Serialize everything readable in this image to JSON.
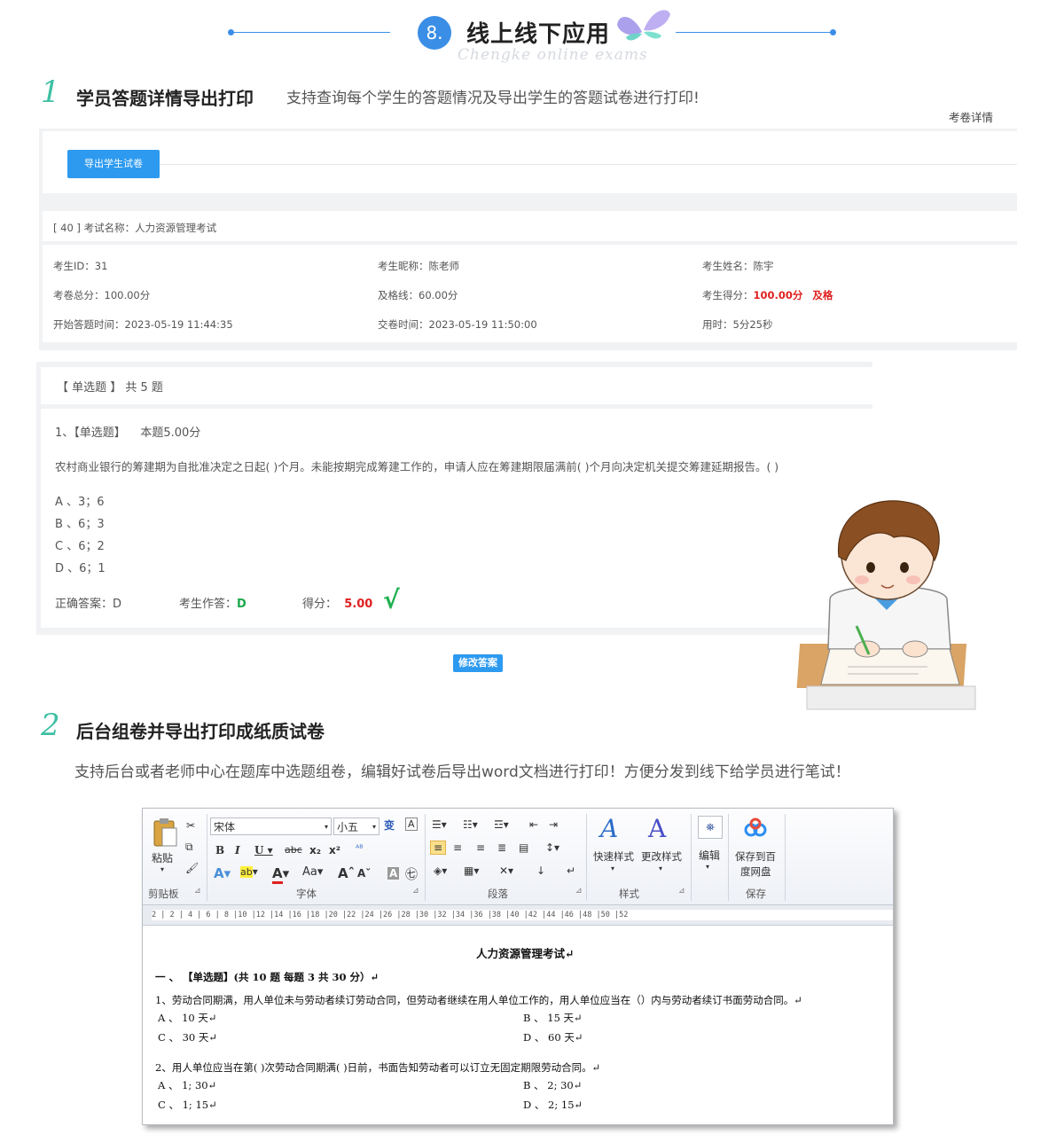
{
  "header": {
    "badge": "8.",
    "title": "线上线下应用",
    "subtitle": "Chengke online exams"
  },
  "section1": {
    "number": "1",
    "title": "学员答题详情导出打印",
    "desc": "支持查询每个学生的答题情况及导出学生的答题试卷进行打印!",
    "tab_label": "考卷详情",
    "export_button": "导出学生试卷",
    "exam_header": "[ 40 ] 考试名称：人力资源管理考试",
    "info": {
      "student_id": "考生ID：31",
      "nickname": "考生昵称：陈老师",
      "name": "考生姓名：陈宇",
      "total_label": "考卷总分：100.00分",
      "pass_line": "及格线：60.00分",
      "score_label": "考生得分：",
      "score_value": "100.00分",
      "pass_status": "及格",
      "start_time": "开始答题时间：2023-05-19 11:44:35",
      "submit_time": "交卷时间：2023-05-19 11:50:00",
      "duration": "用时：5分25秒"
    },
    "question_type_header": "【 单选题 】 共 5 题",
    "question": {
      "head": "1、【单选题】",
      "points": "本题5.00分",
      "text": "农村商业银行的筹建期为自批准决定之日起( )个月。未能按期完成筹建工作的，申请人应在筹建期限届满前( )个月向决定机关提交筹建延期报告。( )",
      "options": [
        "A 、3；6",
        "B 、6；3",
        "C 、6；2",
        "D 、6；1"
      ],
      "correct_label": "正确答案：D",
      "answer_label": "考生作答：",
      "answer_value": "D",
      "score_label": "得分：",
      "score_value": "5.00",
      "check_mark": "√"
    },
    "modify_button": "修改答案"
  },
  "section2": {
    "number": "2",
    "title": "后台组卷并导出打印成纸质试卷",
    "desc": "支持后台或者老师中心在题库中选题组卷，编辑好试卷后导出word文档进行打印！方便分发到线下给学员进行笔试！"
  },
  "word": {
    "paste": "粘贴",
    "font_name": "宋体",
    "font_size": "小五",
    "quick_style": "快速样式",
    "change_style": "更改样式",
    "edit": "编辑",
    "save_baidu_1": "保存到百",
    "save_baidu_2": "度网盘",
    "groups": [
      "剪贴板",
      "字体",
      "段落",
      "样式",
      "保存"
    ],
    "ruler": "2 | 2 | 4 | 6 | 8 |10 |12 |14 |16 |18 |20 |22 |24 |26 |28 |30 |32 |34 |36 |38 |40 |42 |44 |46 |48 |50 |52",
    "doc_title": "人力资源管理考试↵",
    "section_head": "一 、  【单选题】(共 10 题 每题 3 共 30 分）↵",
    "q1": "1、劳动合同期满，用人单位未与劳动者续订劳动合同，但劳动者继续在用人单位工作的，用人单位应当在（）内与劳动者续订书面劳动合同。↵",
    "q1_opts": [
      "A 、 10 天↵",
      "B 、 15 天↵",
      "C 、 30 天↵",
      "D 、 60 天↵"
    ],
    "q2": "2、用人单位应当在第( )次劳动合同期满( )日前，书面告知劳动者可以订立无固定期限劳动合同。↵",
    "q2_opts": [
      "A 、 1; 30↵",
      "B 、 2; 30↵",
      "C 、 1; 15↵",
      "D 、 2; 15↵"
    ]
  }
}
